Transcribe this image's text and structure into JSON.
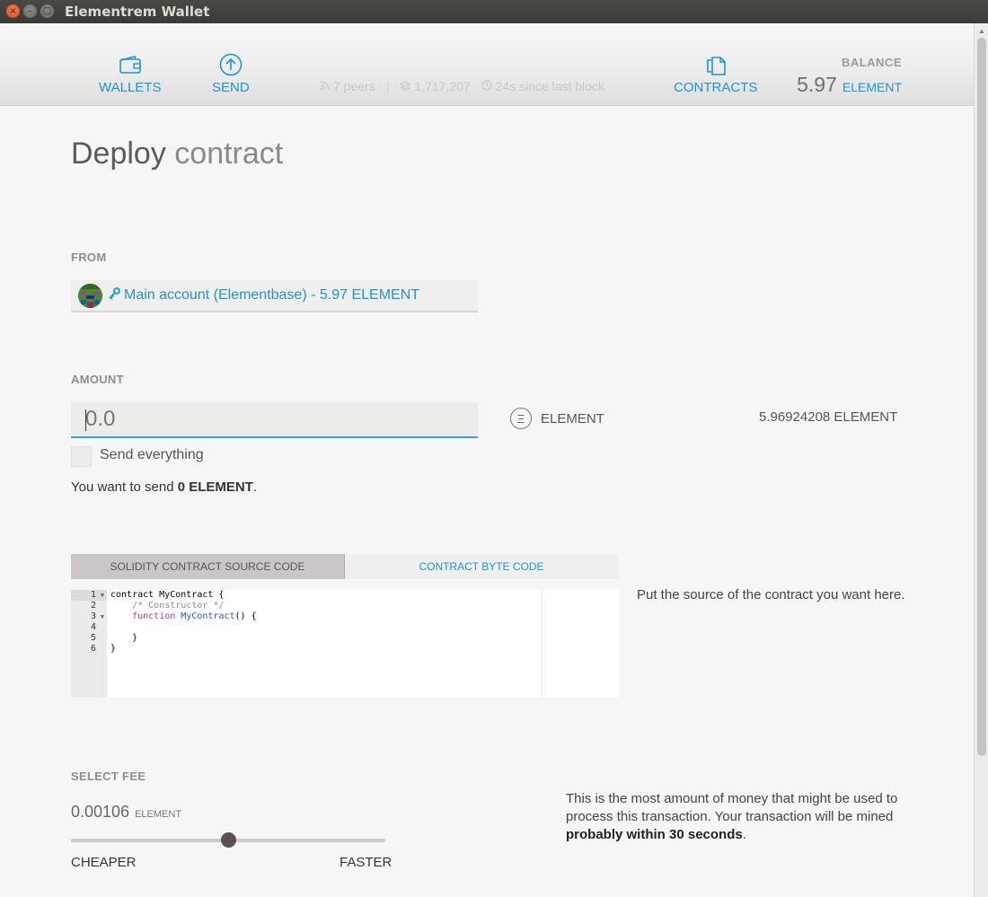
{
  "window": {
    "title": "Elementrem Wallet"
  },
  "nav": {
    "wallets": "WALLETS",
    "send": "SEND",
    "contracts": "CONTRACTS"
  },
  "network": {
    "peers": "7 peers",
    "block": "1,717,207",
    "since": "24s since last block"
  },
  "balance": {
    "label": "BALANCE",
    "value": "5.97",
    "unit": "ELEMENT"
  },
  "page": {
    "title_bold": "Deploy",
    "title_light": "contract"
  },
  "from": {
    "label": "FROM",
    "account": "Main account (Elementbase) - 5.97 ELEMENT"
  },
  "amount": {
    "label": "AMOUNT",
    "placeholder": "0.0",
    "currency": "ELEMENT",
    "currency_symbol": "Ξ",
    "available": "5.96924208 ELEMENT",
    "send_everything": "Send everything",
    "summary_prefix": "You want to send ",
    "summary_value": "0 ELEMENT",
    "summary_suffix": "."
  },
  "tabs": {
    "source": "SOLIDITY CONTRACT SOURCE CODE",
    "bytecode": "CONTRACT BYTE CODE"
  },
  "editor": {
    "line_numbers": [
      "1",
      "2",
      "3",
      "4",
      "5",
      "6"
    ],
    "hint": "Put the source of the contract you want here."
  },
  "fee": {
    "label": "SELECT FEE",
    "value": "0.00106",
    "unit": "ELEMENT",
    "slider_level": 0.5,
    "cheaper": "CHEAPER",
    "faster": "FASTER",
    "note_text": "This is the most amount of money that might be used to process this transaction. Your transaction will be mined ",
    "note_bold": "probably within 30 seconds",
    "note_end": "."
  },
  "colors": {
    "accent": "#1e94d2",
    "titlebar": "#3c3b37"
  }
}
